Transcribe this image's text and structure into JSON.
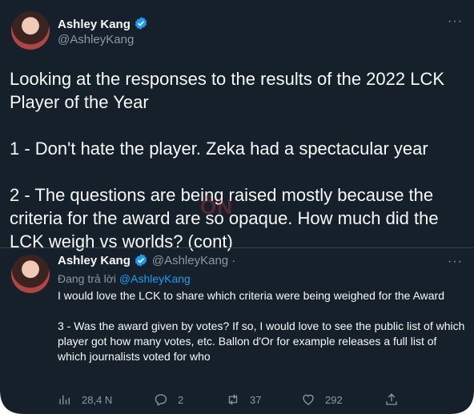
{
  "main": {
    "name": "Ashley Kang",
    "handle": "@AshleyKang",
    "more": "···",
    "text": "Looking at the responses to the results of the 2022 LCK Player of the Year\n\n1 - Don't hate the player. Zeka had a spectacular year\n\n2 - The questions are being raised mostly because the criteria for the award are so opaque. How much did the LCK weigh vs worlds? (cont)"
  },
  "reply": {
    "name": "Ashley Kang",
    "handle": "@AshleyKang ·",
    "more": "···",
    "replying_prefix": "Đang trả lời ",
    "replying_to": "@AshleyKang",
    "text": "I would love the LCK to share which criteria were being weighed for the Award\n\n3 - Was the award given by votes? If so, I would love to see the public list of which player got how many votes, etc. Ballon d'Or for example releases a full list of which journalists voted for who"
  },
  "actions": {
    "views": "28,4 N",
    "replies": "2",
    "retweets": "37",
    "likes": "292"
  },
  "watermark": "ÔN",
  "colors": {
    "background": "#15202b",
    "verified": "#1d9bf0",
    "link": "#1d9bf0",
    "muted": "#8b98a5"
  },
  "icons": [
    "verified-badge-icon",
    "more-icon",
    "views-icon",
    "reply-icon",
    "retweet-icon",
    "like-icon",
    "share-icon"
  ]
}
